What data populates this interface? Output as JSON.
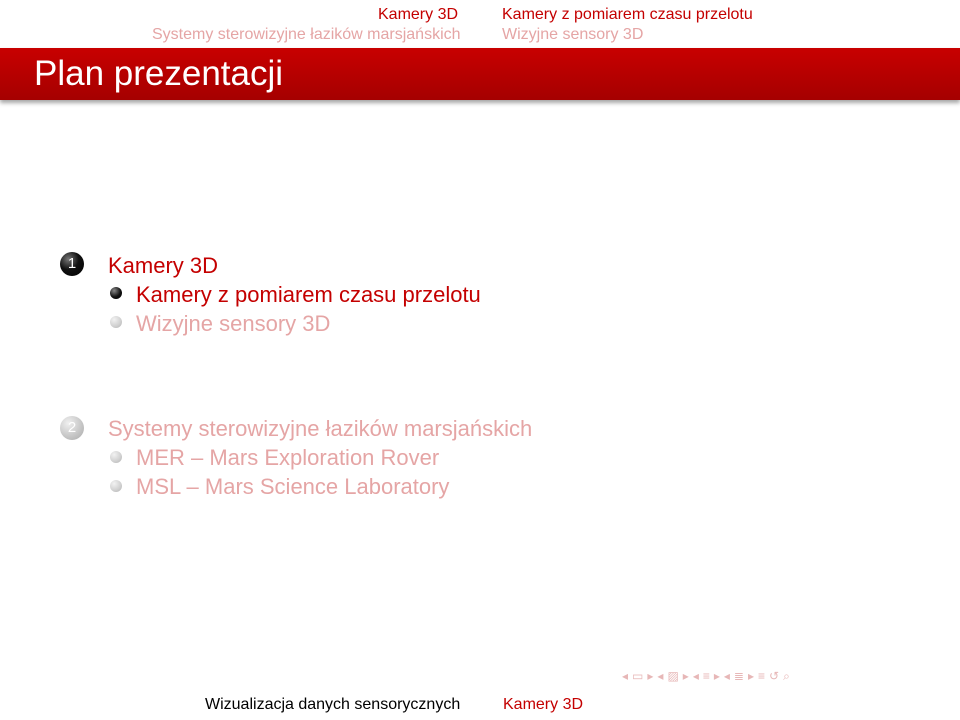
{
  "header": {
    "left_section": "Kamery 3D",
    "left_subsection": "Systemy sterowizyjne łazików marsjańskich",
    "right_section": "Kamery z pomiarem czasu przelotu",
    "right_subsection": "Wizyjne sensory 3D"
  },
  "title": "Plan prezentacji",
  "toc": [
    {
      "number": "1",
      "label": "Kamery 3D",
      "subitems": [
        "Kamery z pomiarem czasu przelotu",
        "Wizyjne sensory 3D"
      ]
    },
    {
      "number": "2",
      "label": "Systemy sterowizyjne łazików marsjańskich",
      "subitems": [
        "MER – Mars Exploration Rover",
        "MSL – Mars Science Laboratory"
      ]
    }
  ],
  "footer": {
    "presentation": "Wizualizacja danych sensorycznych",
    "section": "Kamery 3D"
  },
  "nav": {
    "icons": [
      "nav-left-arrow-icon",
      "frame-icon",
      "nav-right-arrow-icon",
      "nav-left-arrow-icon",
      "slide-icon",
      "nav-right-arrow-icon",
      "nav-left-arrow-icon",
      "subsection-icon",
      "nav-right-arrow-icon",
      "nav-left-arrow-icon",
      "section-icon",
      "nav-right-arrow-icon",
      "align-icon",
      "undo-icon",
      "zoom-icon"
    ]
  },
  "colors": {
    "accent": "#c80000",
    "title_bar": "#b00000",
    "inactive_text": "#e5a5a5",
    "active_text": "#c40000"
  }
}
